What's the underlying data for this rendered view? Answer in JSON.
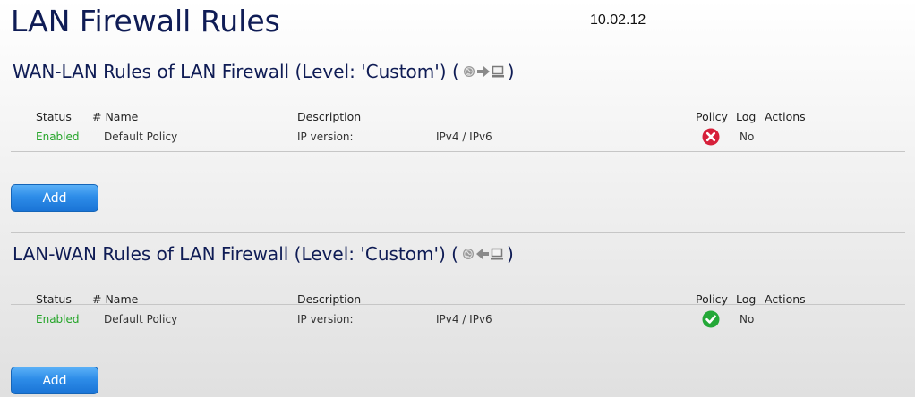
{
  "page": {
    "title": "LAN Firewall Rules",
    "version": "10.02.12"
  },
  "sections": [
    {
      "title_prefix": "WAN-LAN Rules of LAN Firewall (Level: 'Custom') (",
      "title_suffix": ")",
      "direction_icons": [
        "globe-icon",
        "arrow-right-icon",
        "computer-icon"
      ],
      "columns": {
        "status": "Status",
        "name": "# Name",
        "description": "Description",
        "policy": "Policy",
        "log": "Log",
        "actions": "Actions"
      },
      "rows": [
        {
          "status": "Enabled",
          "name": "Default Policy",
          "description": "IP version:",
          "ip_version": "IPv4 / IPv6",
          "policy": "deny",
          "log": "No"
        }
      ],
      "add_label": "Add"
    },
    {
      "title_prefix": "LAN-WAN Rules of LAN Firewall (Level: 'Custom') (",
      "title_suffix": ")",
      "direction_icons": [
        "globe-icon",
        "arrow-left-icon",
        "computer-icon"
      ],
      "columns": {
        "status": "Status",
        "name": "# Name",
        "description": "Description",
        "policy": "Policy",
        "log": "Log",
        "actions": "Actions"
      },
      "rows": [
        {
          "status": "Enabled",
          "name": "Default Policy",
          "description": "IP version:",
          "ip_version": "IPv4 / IPv6",
          "policy": "allow",
          "log": "No"
        }
      ],
      "add_label": "Add"
    }
  ],
  "colors": {
    "title": "#0f1c55",
    "enabled": "#26a52a",
    "deny": "#d6203a",
    "allow": "#24a838",
    "button": "#2d8ce8"
  }
}
